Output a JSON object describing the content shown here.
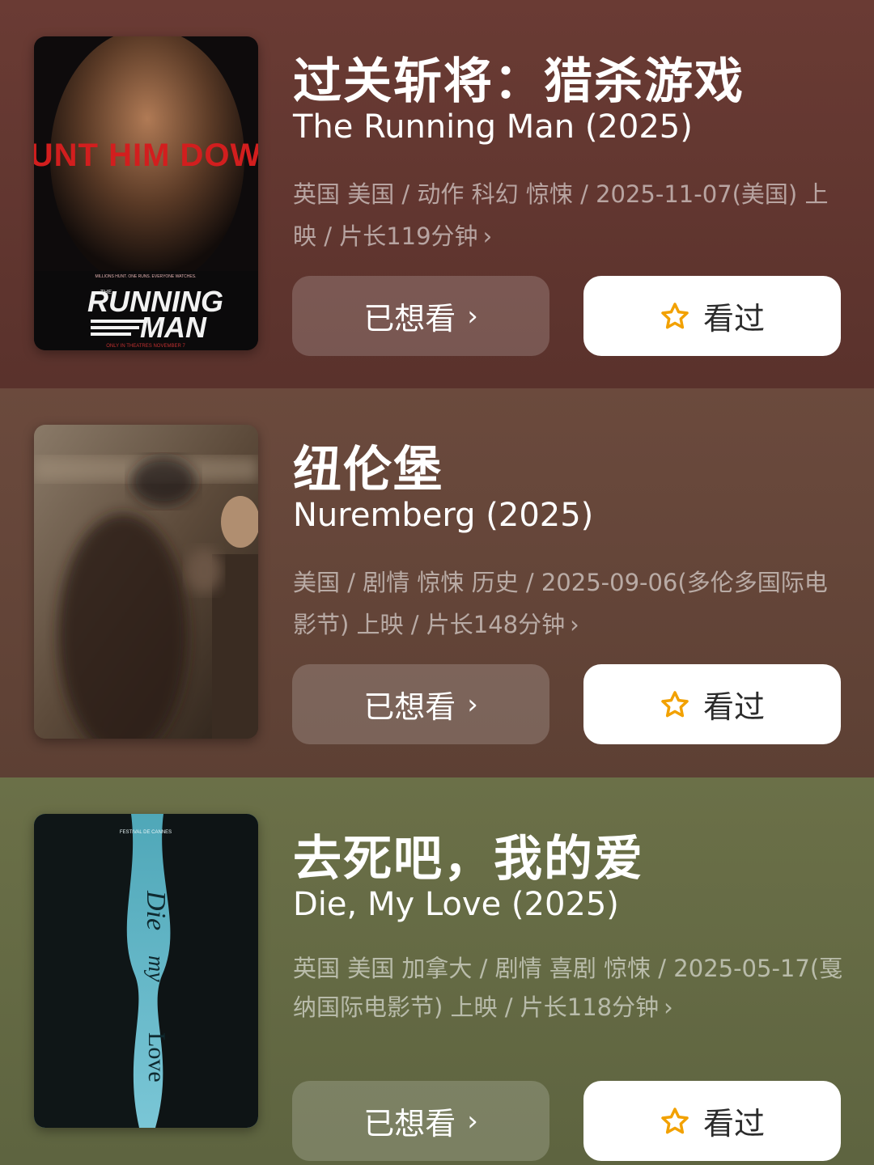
{
  "movies": [
    {
      "title_zh": "过关斩将：猎杀游戏",
      "title_en": "The Running Man (2025)",
      "meta": "英国 美国 / 动作 科幻 惊悚 / 2025-11-07(美国) 上映 / 片长119分钟",
      "poster_text": {
        "tagline": "HUNT HIM DOWN",
        "the": "THE",
        "line1": "RUNNING",
        "line2": "MAN",
        "small_top": "MILLIONS HUNT. ONE RUNS. EVERYONE WATCHES.",
        "small_bottom": "ONLY IN THEATRES NOVEMBER 7"
      },
      "want_label": "已想看",
      "seen_label": "看过",
      "colors": {
        "background": "#6a3b34"
      }
    },
    {
      "title_zh": "纽伦堡",
      "title_en": "Nuremberg (2025)",
      "meta": "美国 / 剧情 惊悚 历史 / 2025-09-06(多伦多国际电影节) 上映 / 片长148分钟",
      "want_label": "已想看",
      "seen_label": "看过",
      "colors": {
        "background": "#6b4a3d"
      }
    },
    {
      "title_zh": "去死吧，我的爱",
      "title_en": "Die, My Love (2025)",
      "meta": "英国 美国 加拿大 / 剧情 喜剧 惊悚 / 2025-05-17(戛纳国际电影节) 上映 / 片长118分钟",
      "poster_text": {
        "festival": "FESTIVAL DE CANNES",
        "word1": "Die",
        "word2": "my",
        "word3": "Love"
      },
      "want_label": "已想看",
      "seen_label": "看过",
      "colors": {
        "background": "#6b7048"
      }
    }
  ],
  "icons": {
    "chevron": "›",
    "star": "star-outline-icon"
  },
  "colors": {
    "star_stroke": "#f2a100",
    "seen_button_bg": "#ffffff",
    "want_button_bg": "rgba(255,255,255,0.18)"
  }
}
